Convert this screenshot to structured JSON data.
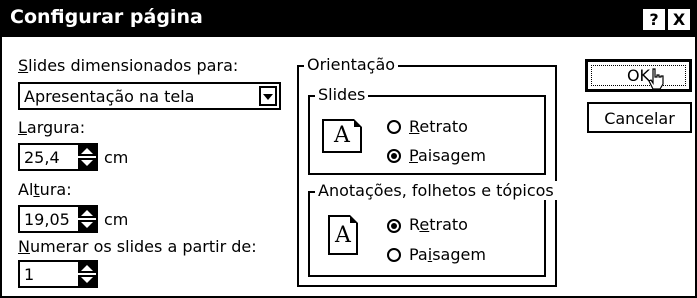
{
  "window": {
    "title": "Configurar página",
    "help_label": "?",
    "close_label": "X"
  },
  "size": {
    "label": "Slides dimensionados para:",
    "selected": "Apresentação na tela"
  },
  "width": {
    "label": "Largura:",
    "value": "25,4",
    "unit": "cm"
  },
  "height": {
    "label": "Altura:",
    "value": "19,05",
    "unit": "cm"
  },
  "numbering": {
    "label": "Numerar os slides a partir de:",
    "value": "1"
  },
  "orientation": {
    "title": "Orientação",
    "slides": {
      "title": "Slides",
      "options": [
        {
          "label": "Retrato",
          "selected": false
        },
        {
          "label": "Paisagem",
          "selected": true
        }
      ]
    },
    "notes": {
      "title": "Anotações, folhetos e  tópicos",
      "options": [
        {
          "label": "Retrato",
          "selected": true
        },
        {
          "label": "Paisagem",
          "selected": false
        }
      ]
    },
    "page_icon_letter": "A"
  },
  "buttons": {
    "ok": "OK",
    "cancel": "Cancelar"
  }
}
